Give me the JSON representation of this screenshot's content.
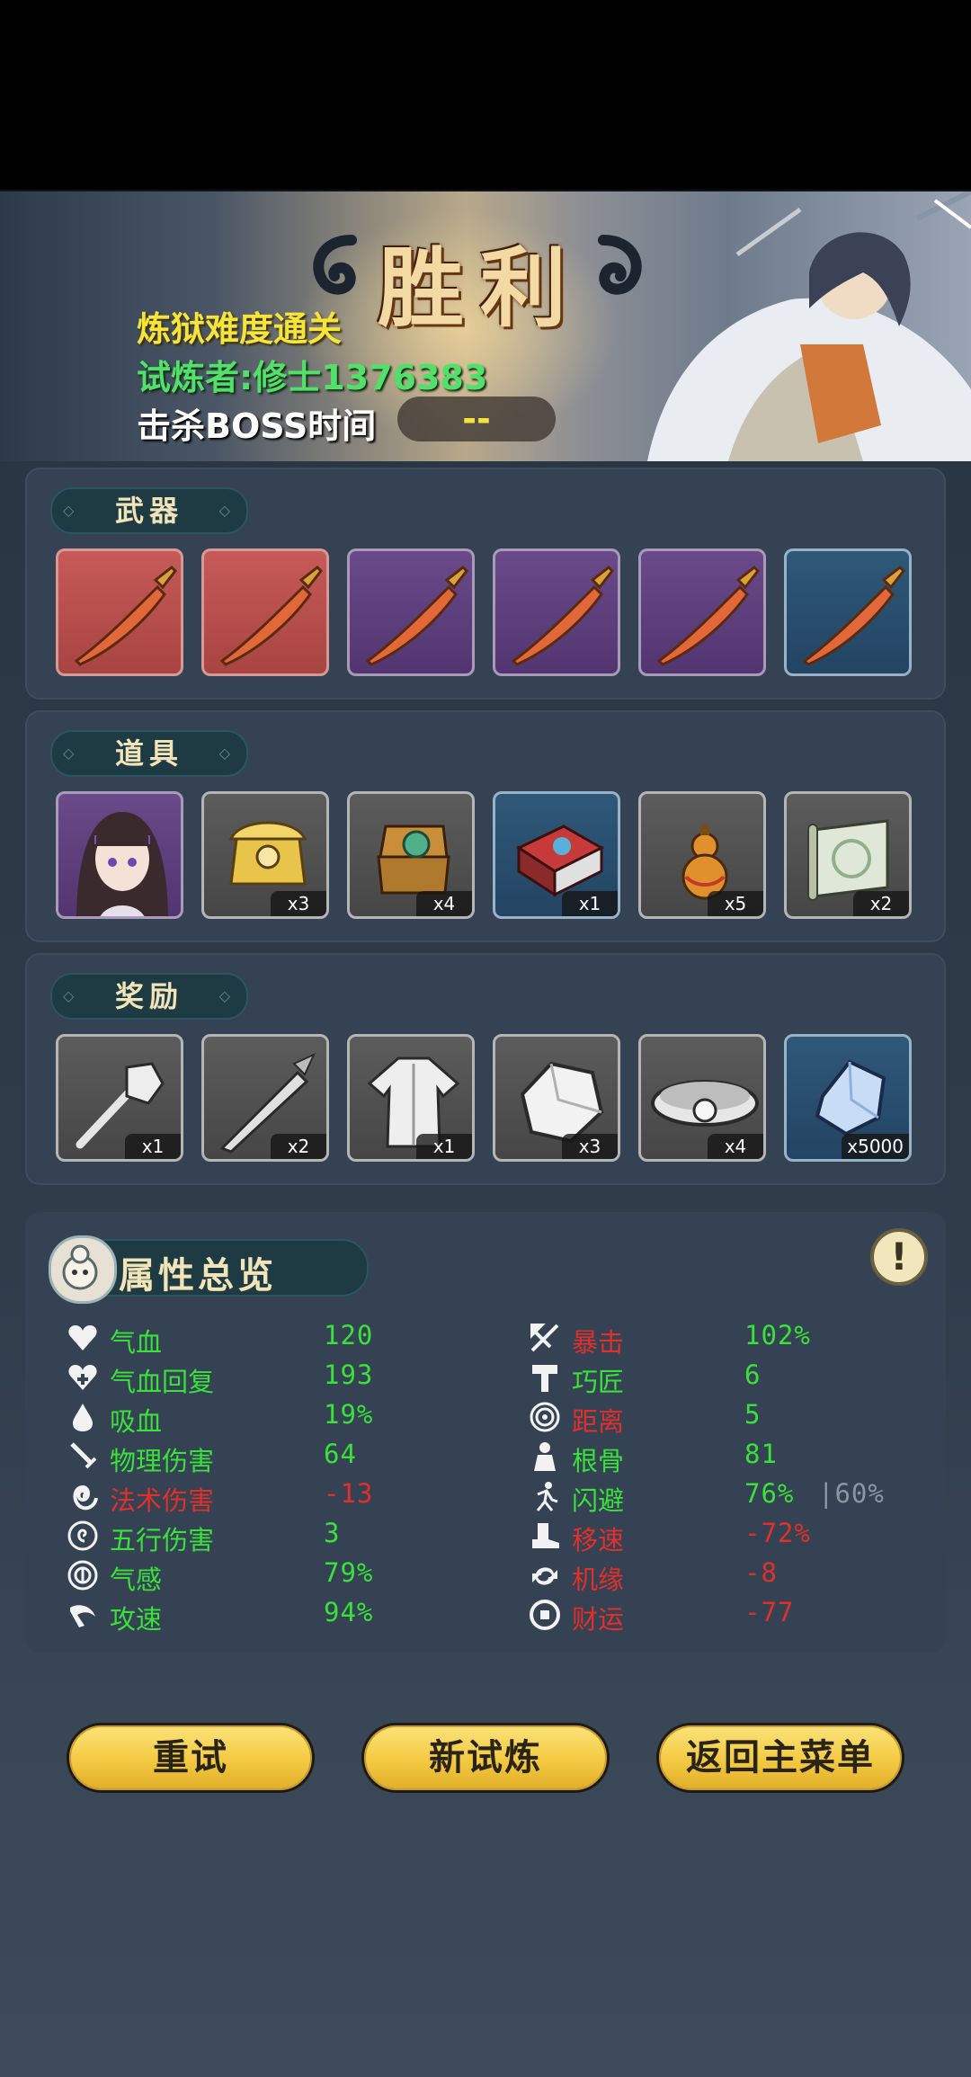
{
  "result": {
    "title": "胜利",
    "difficulty": "炼狱难度通关",
    "challenger": "试炼者:修士1376383",
    "boss_time_label": "击杀BOSS时间",
    "boss_time_value": "--"
  },
  "weapons": {
    "label": "武器",
    "items": [
      {
        "icon": "sword-icon",
        "rarity": "red"
      },
      {
        "icon": "sword-icon",
        "rarity": "red"
      },
      {
        "icon": "sword-icon",
        "rarity": "purple"
      },
      {
        "icon": "sword-icon",
        "rarity": "purple"
      },
      {
        "icon": "sword-icon",
        "rarity": "purple"
      },
      {
        "icon": "sword-icon",
        "rarity": "blue"
      }
    ]
  },
  "props": {
    "label": "道具",
    "items": [
      {
        "icon": "companion-portrait",
        "qty": ""
      },
      {
        "icon": "golden-chest-icon",
        "qty": "x3"
      },
      {
        "icon": "jade-chest-icon",
        "qty": "x4"
      },
      {
        "icon": "book-icon",
        "qty": "x1"
      },
      {
        "icon": "gourd-icon",
        "qty": "x5"
      },
      {
        "icon": "scroll-icon",
        "qty": "x2"
      }
    ]
  },
  "rewards": {
    "label": "奖励",
    "items": [
      {
        "icon": "hammer-icon",
        "qty": "x1"
      },
      {
        "icon": "blade-icon",
        "qty": "x2"
      },
      {
        "icon": "robe-icon",
        "qty": "x1"
      },
      {
        "icon": "ore-icon",
        "qty": "x3"
      },
      {
        "icon": "belt-icon",
        "qty": "x4"
      },
      {
        "icon": "crystal-icon",
        "qty": "x5000"
      }
    ]
  },
  "attributes": {
    "title": "属性总览",
    "info_icon": "!",
    "left": [
      {
        "icon": "heart-icon",
        "name": "气血",
        "value": "120",
        "tone": "good"
      },
      {
        "icon": "heart-regen-icon",
        "name": "气血回复",
        "value": "193",
        "tone": "good"
      },
      {
        "icon": "blood-drop-icon",
        "name": "吸血",
        "value": "19%",
        "tone": "good"
      },
      {
        "icon": "sword-icon",
        "name": "物理伤害",
        "value": "64",
        "tone": "good"
      },
      {
        "icon": "spiral-icon",
        "name": "法术伤害",
        "value": "-13",
        "tone": "bad"
      },
      {
        "icon": "swirl-icon",
        "name": "五行伤害",
        "value": "3",
        "tone": "good"
      },
      {
        "icon": "sense-icon",
        "name": "气感",
        "value": "79%",
        "tone": "good"
      },
      {
        "icon": "attack-speed-icon",
        "name": "攻速",
        "value": "94%",
        "tone": "good"
      }
    ],
    "right": [
      {
        "icon": "crit-icon",
        "name": "暴击",
        "value": "102%",
        "tone": "good"
      },
      {
        "icon": "craft-icon",
        "name": "巧匠",
        "value": "6",
        "tone": "good"
      },
      {
        "icon": "range-icon",
        "name": "距离",
        "value": "5",
        "tone": "good"
      },
      {
        "icon": "root-icon",
        "name": "根骨",
        "value": "81",
        "tone": "good"
      },
      {
        "icon": "dodge-icon",
        "name": "闪避",
        "value": "76%",
        "extra": "|60%",
        "tone": "good"
      },
      {
        "icon": "boot-icon",
        "name": "移速",
        "value": "-72%",
        "tone": "bad"
      },
      {
        "icon": "luck-icon",
        "name": "机缘",
        "value": "-8",
        "tone": "bad"
      },
      {
        "icon": "coin-icon",
        "name": "财运",
        "value": "-77",
        "tone": "bad"
      }
    ]
  },
  "buttons": {
    "retry": "重试",
    "new_trial": "新试炼",
    "main_menu": "返回主菜单"
  },
  "colors": {
    "good": "#3ae13a",
    "bad": "#e1302a",
    "gold": "#f3c941",
    "difficulty": "#f5e53a",
    "challenger": "#52e06a"
  }
}
